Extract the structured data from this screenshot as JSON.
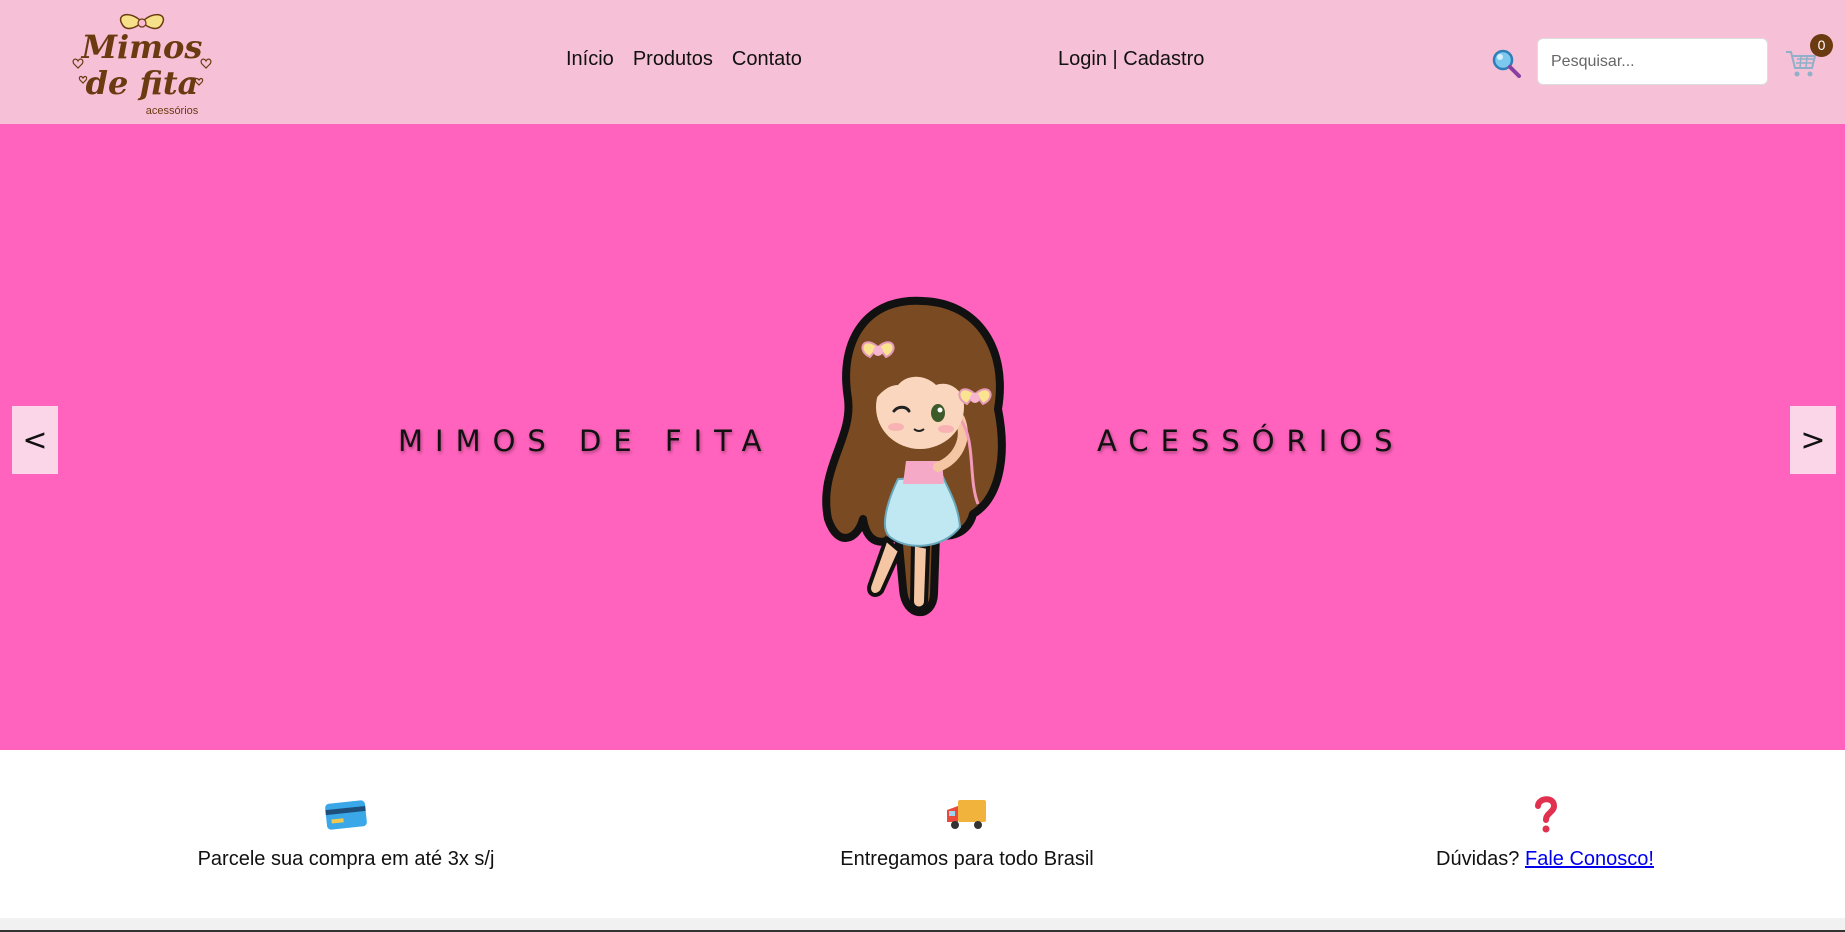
{
  "header": {
    "logo": {
      "line1": "Mimos",
      "line2": "de fita",
      "sub": "acessórios"
    },
    "nav": [
      {
        "label": "Início"
      },
      {
        "label": "Produtos"
      },
      {
        "label": "Contato"
      }
    ],
    "auth_label": "Login | Cadastro",
    "search": {
      "placeholder": "Pesquisar...",
      "value": "",
      "icon": "search-icon"
    },
    "cart": {
      "icon": "cart-icon",
      "count": "0"
    }
  },
  "hero": {
    "left_text": "MIMOS DE FITA",
    "right_text": "ACESSÓRIOS",
    "prev_label": "<",
    "next_label": ">",
    "background": "#ff63bd"
  },
  "features": [
    {
      "icon": "credit-card-icon",
      "text": "Parcele sua compra em até 3x s/j"
    },
    {
      "icon": "delivery-truck-icon",
      "text": "Entregamos para todo Brasil"
    },
    {
      "icon": "question-mark-icon",
      "text": "Dúvidas?",
      "link": "Fale Conosco!"
    }
  ],
  "colors": {
    "header_bg": "#f6c0d6",
    "hero_bg": "#ff63bd",
    "brand_brown": "#6b3a10",
    "link": "#0000ee"
  }
}
